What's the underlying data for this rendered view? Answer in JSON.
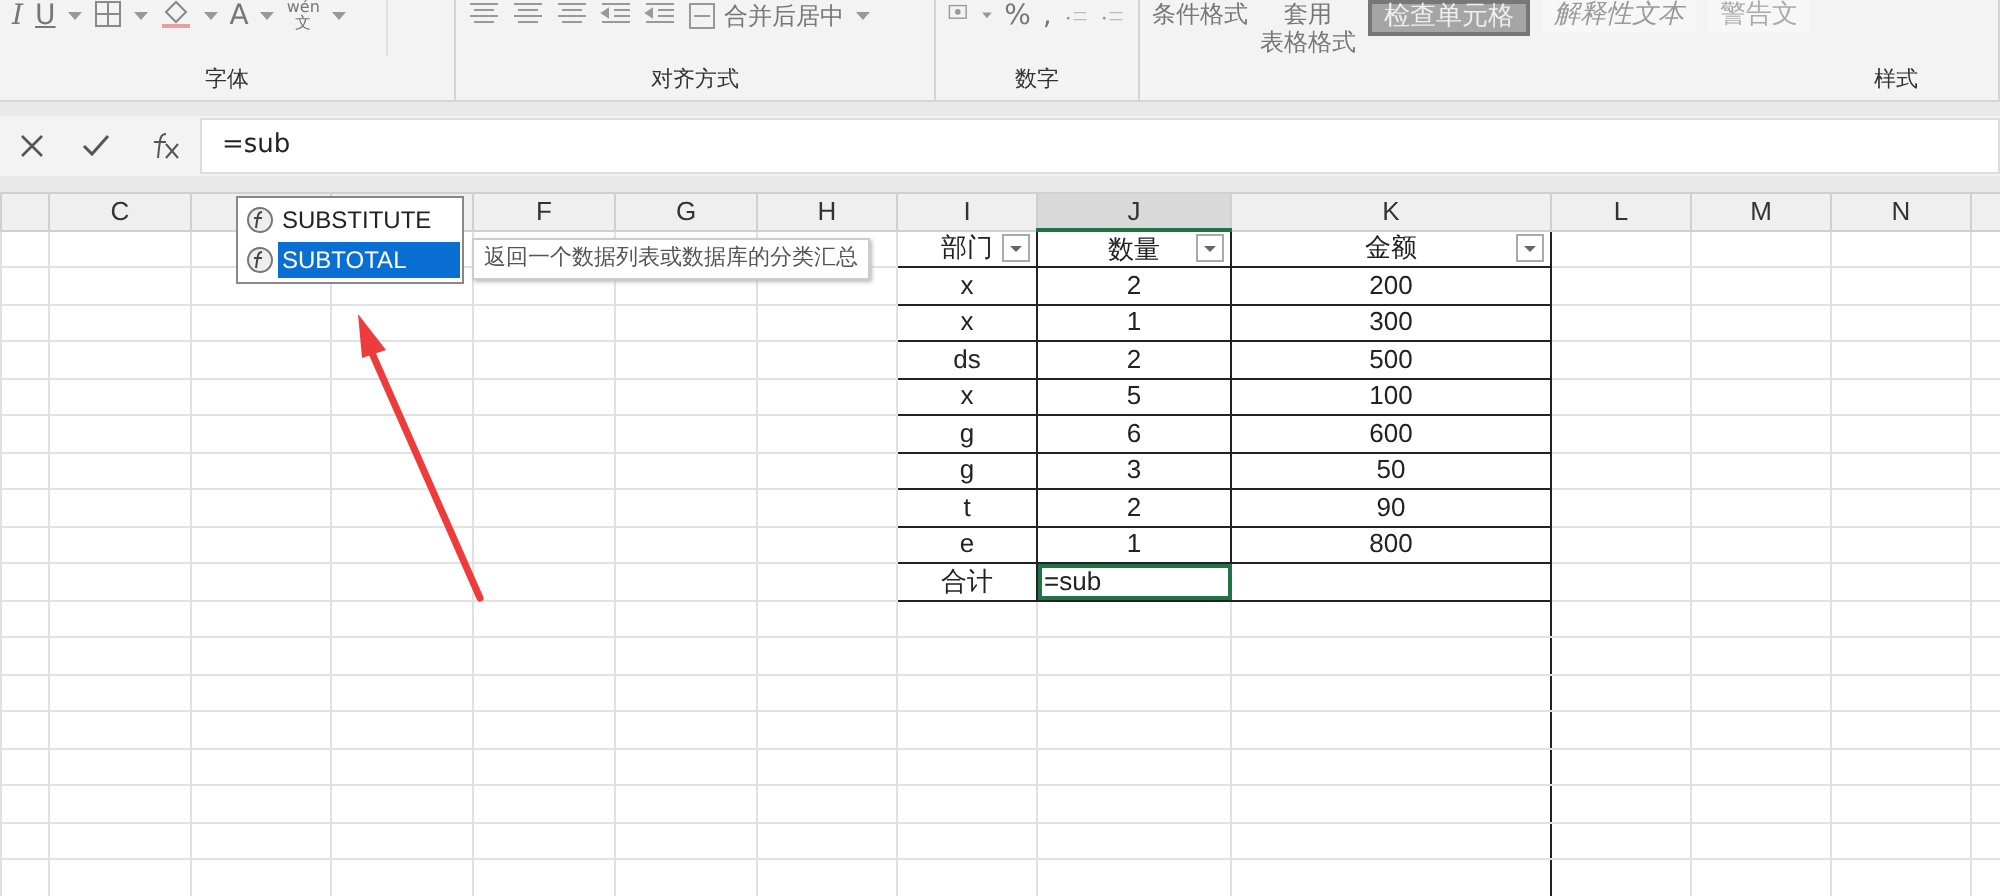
{
  "ribbon": {
    "groups": [
      {
        "label": "字体",
        "items": [
          {
            "kind": "italic",
            "text": "I"
          },
          {
            "kind": "underline",
            "text": "U"
          },
          {
            "kind": "borders"
          },
          {
            "kind": "fill"
          },
          {
            "kind": "fontcolor",
            "text": "A"
          },
          {
            "kind": "phonetic",
            "text": "wén",
            "sub": "文"
          }
        ]
      },
      {
        "label": "对齐方式",
        "items": [
          {
            "kind": "align"
          },
          {
            "kind": "align"
          },
          {
            "kind": "align"
          },
          {
            "kind": "indent"
          },
          {
            "kind": "indent"
          },
          {
            "kind": "merge",
            "text": "合并后居中"
          }
        ]
      },
      {
        "label": "数字",
        "items": [
          {
            "kind": "currency"
          },
          {
            "kind": "text",
            "text": "%"
          },
          {
            "kind": "text",
            "text": ","
          },
          {
            "kind": "decimal"
          },
          {
            "kind": "decimal"
          }
        ]
      },
      {
        "label": "样式",
        "items": [
          {
            "kind": "split",
            "text": "条件格式"
          },
          {
            "kind": "split",
            "text": "套用",
            "sub": "表格格式"
          },
          {
            "kind": "check",
            "text": "检查单元格"
          },
          {
            "kind": "explain",
            "text": "解释性文本"
          },
          {
            "kind": "warn",
            "text": "警告文"
          }
        ]
      }
    ]
  },
  "formula_bar": {
    "value": "=sub"
  },
  "column_headers": [
    {
      "label": "C",
      "selected": false
    },
    {
      "label": "F",
      "selected": false
    },
    {
      "label": "G",
      "selected": false
    },
    {
      "label": "H",
      "selected": false
    },
    {
      "label": "I",
      "selected": false
    },
    {
      "label": "J",
      "selected": true
    },
    {
      "label": "K",
      "selected": false
    },
    {
      "label": "L",
      "selected": false
    },
    {
      "label": "M",
      "selected": false
    },
    {
      "label": "N",
      "selected": false
    }
  ],
  "table": {
    "columns": [
      {
        "label": "部门"
      },
      {
        "label": "数量"
      },
      {
        "label": "金额"
      }
    ],
    "rows": [
      [
        "x",
        "2",
        "200"
      ],
      [
        "x",
        "1",
        "300"
      ],
      [
        "ds",
        "2",
        "500"
      ],
      [
        "x",
        "5",
        "100"
      ],
      [
        "g",
        "6",
        "600"
      ],
      [
        "g",
        "3",
        "50"
      ],
      [
        "t",
        "2",
        "90"
      ],
      [
        "e",
        "1",
        "800"
      ]
    ],
    "total": {
      "label": "合计",
      "value": "=sub",
      "active": true
    }
  },
  "autocomplete": {
    "items": [
      {
        "label": "SUBSTITUTE",
        "selected": false
      },
      {
        "label": "SUBTOTAL",
        "selected": true
      }
    ],
    "tooltip": "返回一个数据列表或数据库的分类汇总"
  }
}
